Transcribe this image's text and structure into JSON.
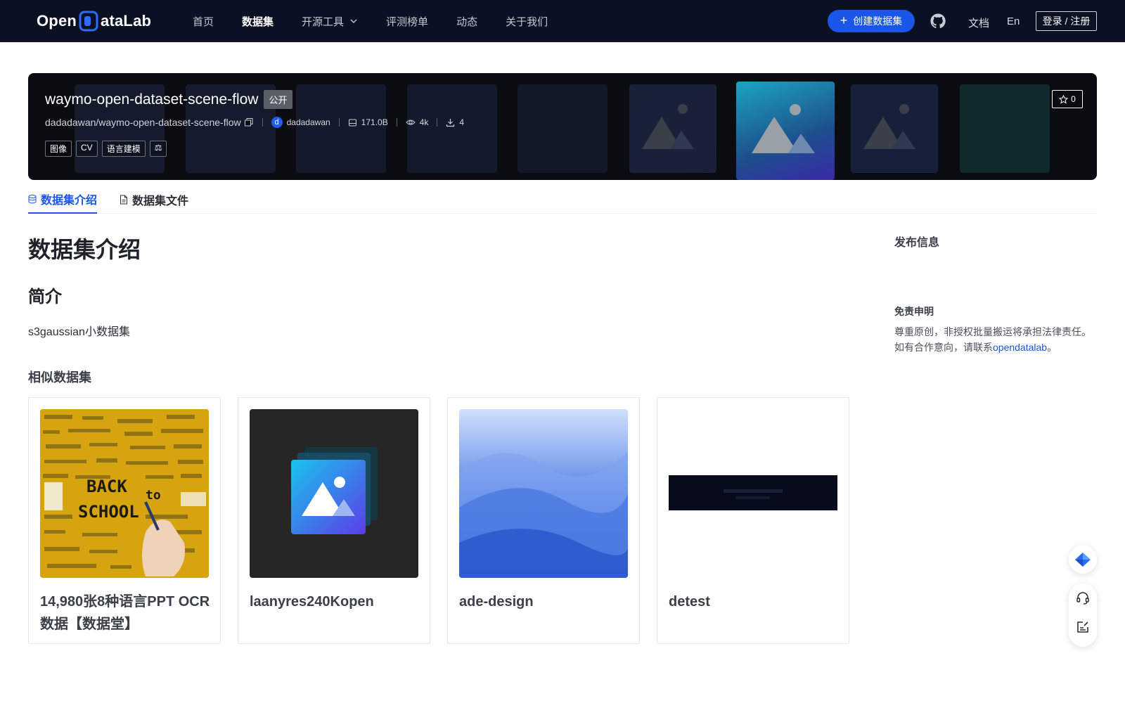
{
  "header": {
    "logo_text_before": "Open",
    "logo_text_after": "ataLab",
    "nav": [
      {
        "label": "首页",
        "active": false
      },
      {
        "label": "数据集",
        "active": true
      },
      {
        "label": "开源工具",
        "active": false,
        "dropdown": true
      },
      {
        "label": "评测榜单",
        "active": false
      },
      {
        "label": "动态",
        "active": false
      },
      {
        "label": "关于我们",
        "active": false
      }
    ],
    "create_label": "创建数据集",
    "docs_label": "文档",
    "lang_label": "En",
    "login_label": "登录 / 注册",
    "accent": "#1a56e8"
  },
  "banner": {
    "name": "waymo-open-dataset-scene-flow",
    "visibility": "公开",
    "path": "dadadawan/waymo-open-dataset-scene-flow",
    "author_initial": "d",
    "author": "dadadawan",
    "size": "171.0B",
    "views": "4k",
    "downloads": "4",
    "tags": [
      "图像",
      "CV",
      "语言建模",
      "⚖"
    ],
    "stars": "0"
  },
  "tabs": [
    {
      "label": "数据集介绍",
      "active": true,
      "icon": "database-icon"
    },
    {
      "label": "数据集文件",
      "active": false,
      "icon": "file-icon"
    }
  ],
  "main": {
    "title": "数据集介绍",
    "section_title": "简介",
    "intro": "s3gaussian小数据集",
    "similar_title": "相似数据集",
    "cards": [
      {
        "title": "14,980张8种语言PPT OCR数据【数据堂】"
      },
      {
        "title": "laanyres240Kopen"
      },
      {
        "title": "ade-design"
      },
      {
        "title": "detest"
      }
    ]
  },
  "sidebar": {
    "publish_title": "发布信息",
    "disclaimer_title": "免责申明",
    "disclaimer_line1": "尊重原创，非授权批量搬运将承担法律责任。",
    "disclaimer_line2_prefix": "如有合作意向，请联系",
    "disclaimer_link": "opendatalab",
    "disclaimer_line2_suffix": "。"
  }
}
